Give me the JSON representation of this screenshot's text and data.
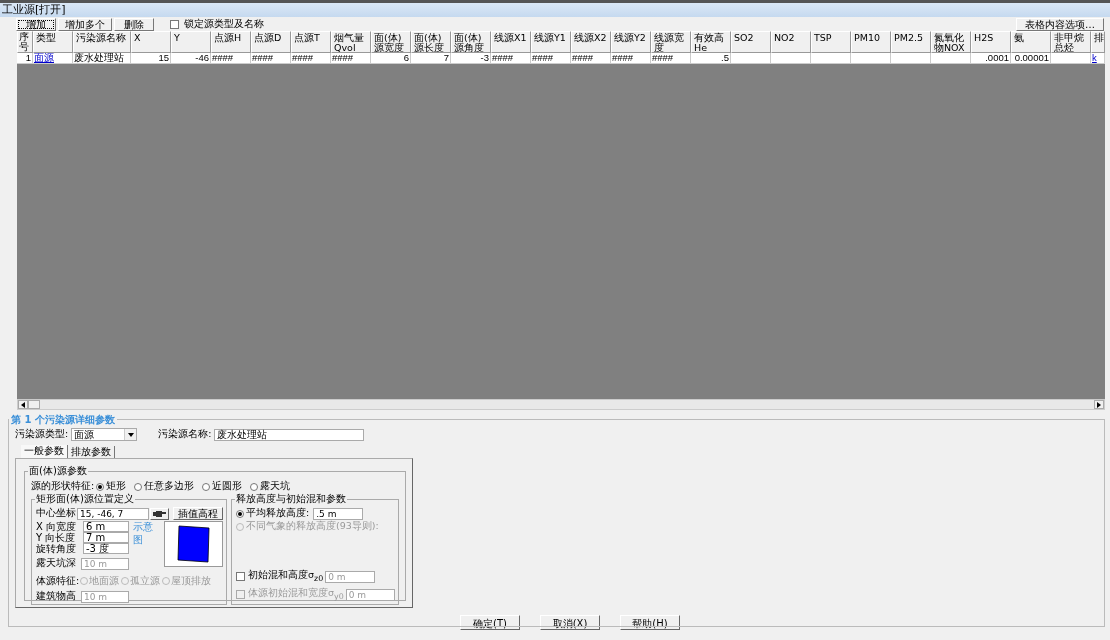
{
  "window": {
    "title": "工业源[打开]"
  },
  "toolbar": {
    "buttons": [
      {
        "label": "增加",
        "focused": true
      },
      {
        "label": "增加多个",
        "focused": false
      },
      {
        "label": "删除",
        "focused": false
      }
    ],
    "lock_checkbox": {
      "label": "锁定源类型及名称",
      "checked": false
    },
    "options_button": "表格内容选项…"
  },
  "table": {
    "columns": [
      {
        "label": "序号",
        "kind": "index"
      },
      {
        "label": "类型",
        "kind": "link"
      },
      {
        "label": "污染源名称",
        "kind": "text"
      },
      {
        "label": "X",
        "kind": "number"
      },
      {
        "label": "Y",
        "kind": "number"
      },
      {
        "label": "点源H",
        "kind": "text"
      },
      {
        "label": "点源D",
        "kind": "text"
      },
      {
        "label": "点源T",
        "kind": "text"
      },
      {
        "label": "烟气量Qvol",
        "kind": "text"
      },
      {
        "label": "面(体)源宽度",
        "kind": "number"
      },
      {
        "label": "面(体)源长度",
        "kind": "number"
      },
      {
        "label": "面(体)源角度",
        "kind": "number"
      },
      {
        "label": "线源X1",
        "kind": "text"
      },
      {
        "label": "线源Y1",
        "kind": "text"
      },
      {
        "label": "线源X2",
        "kind": "text"
      },
      {
        "label": "线源Y2",
        "kind": "text"
      },
      {
        "label": "线源宽度",
        "kind": "text"
      },
      {
        "label": "有效高He",
        "kind": "number"
      },
      {
        "label": "SO2",
        "kind": "number"
      },
      {
        "label": "NO2",
        "kind": "number"
      },
      {
        "label": "TSP",
        "kind": "number"
      },
      {
        "label": "PM10",
        "kind": "number"
      },
      {
        "label": "PM2.5",
        "kind": "number"
      },
      {
        "label": "氮氧化物NOX",
        "kind": "number"
      },
      {
        "label": "H2S",
        "kind": "number"
      },
      {
        "label": "氨",
        "kind": "number"
      },
      {
        "label": "非甲烷总烃",
        "kind": "number"
      },
      {
        "label": "排",
        "kind": "link"
      }
    ],
    "rows": [
      {
        "cells": [
          "1",
          "面源",
          "废水处理站",
          "15",
          "-46",
          "####",
          "####",
          "####",
          "####",
          "6",
          "7",
          "-3",
          "####",
          "####",
          "####",
          "####",
          "####",
          ".5",
          null,
          null,
          null,
          null,
          null,
          null,
          ".0001",
          "0.00001",
          null,
          "k"
        ]
      }
    ]
  },
  "detail": {
    "title": "第 1 个污染源详细参数",
    "source_type_label": "污染源类型:",
    "source_type": "面源",
    "source_name_label": "污染源名称:",
    "source_name": "废水处理站",
    "tabs": [
      {
        "label": "一般参数",
        "selected": true
      },
      {
        "label": "排放参数",
        "selected": false
      }
    ],
    "area_group": {
      "title": "面(体)源参数",
      "shape_label": "源的形状特征:",
      "shapes": [
        {
          "label": "矩形",
          "selected": true
        },
        {
          "label": "任意多边形",
          "selected": false
        },
        {
          "label": "近圆形",
          "selected": false
        },
        {
          "label": "露天坑",
          "selected": false
        }
      ]
    },
    "rect_group": {
      "title": "矩形面(体)源位置定义",
      "center": {
        "label": "中心坐标",
        "value": "15, -46, 7"
      },
      "interp_button": "插值高程",
      "fields": [
        {
          "label": "X 向宽度",
          "value": "6 m"
        },
        {
          "label": "Y 向长度",
          "value": "7 m"
        },
        {
          "label": "旋转角度",
          "value": "-3 度"
        }
      ],
      "diagram_link": "示意图",
      "pit_depth": {
        "label": "露天坑深",
        "value": "10 m",
        "disabled": true
      },
      "volume_label": "体源特征:",
      "volume_options": [
        {
          "label": "地面源",
          "selected": false,
          "disabled": true
        },
        {
          "label": "孤立源",
          "selected": false,
          "disabled": true
        },
        {
          "label": "屋顶排放",
          "selected": false,
          "disabled": true
        }
      ],
      "building_height": {
        "label": "建筑物高",
        "value": "10 m",
        "disabled": true
      }
    },
    "release_group": {
      "title": "释放高度与初始混和参数",
      "options": [
        {
          "label": "平均释放高度:",
          "selected": true,
          "disabled": false
        },
        {
          "label": "不同气象的释放高度(93导则):",
          "selected": false,
          "disabled": true
        }
      ],
      "avg_height": ".5 m",
      "checks": [
        {
          "label": "初始混和高度σ$_{z0}$",
          "checked": false,
          "disabled": false,
          "value": "0 m"
        },
        {
          "label": "体源初始混和宽度σ$_{y0}$",
          "checked": false,
          "disabled": true,
          "value": "0 m"
        }
      ]
    }
  },
  "footer_buttons": [
    "确定(T)",
    "取消(X)",
    "帮助(H)"
  ]
}
